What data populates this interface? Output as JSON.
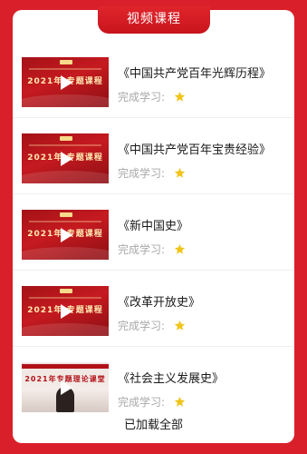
{
  "header": {
    "title": "视频课程"
  },
  "videos": [
    {
      "title": "《中国共产党百年光辉历程》",
      "status_label": "完成学习:",
      "thumb_text": "2021年·专题课程",
      "thumb_style": "red"
    },
    {
      "title": "《中国共产党百年宝贵经验》",
      "status_label": "完成学习:",
      "thumb_text": "2021年·专题课程",
      "thumb_style": "red"
    },
    {
      "title": "《新中国史》",
      "status_label": "完成学习:",
      "thumb_text": "2021年·专题课程",
      "thumb_style": "red"
    },
    {
      "title": "《改革开放史》",
      "status_label": "完成学习:",
      "thumb_text": "2021年·专题课程",
      "thumb_style": "red"
    },
    {
      "title": "《社会主义发展史》",
      "status_label": "完成学习:",
      "thumb_text": "2021年专题理论课堂",
      "thumb_style": "lecture"
    }
  ],
  "footer": {
    "text": "已加载全部"
  },
  "colors": {
    "background": "#d9202a",
    "star": "#f0c419",
    "status_text": "#a8a8a8"
  }
}
